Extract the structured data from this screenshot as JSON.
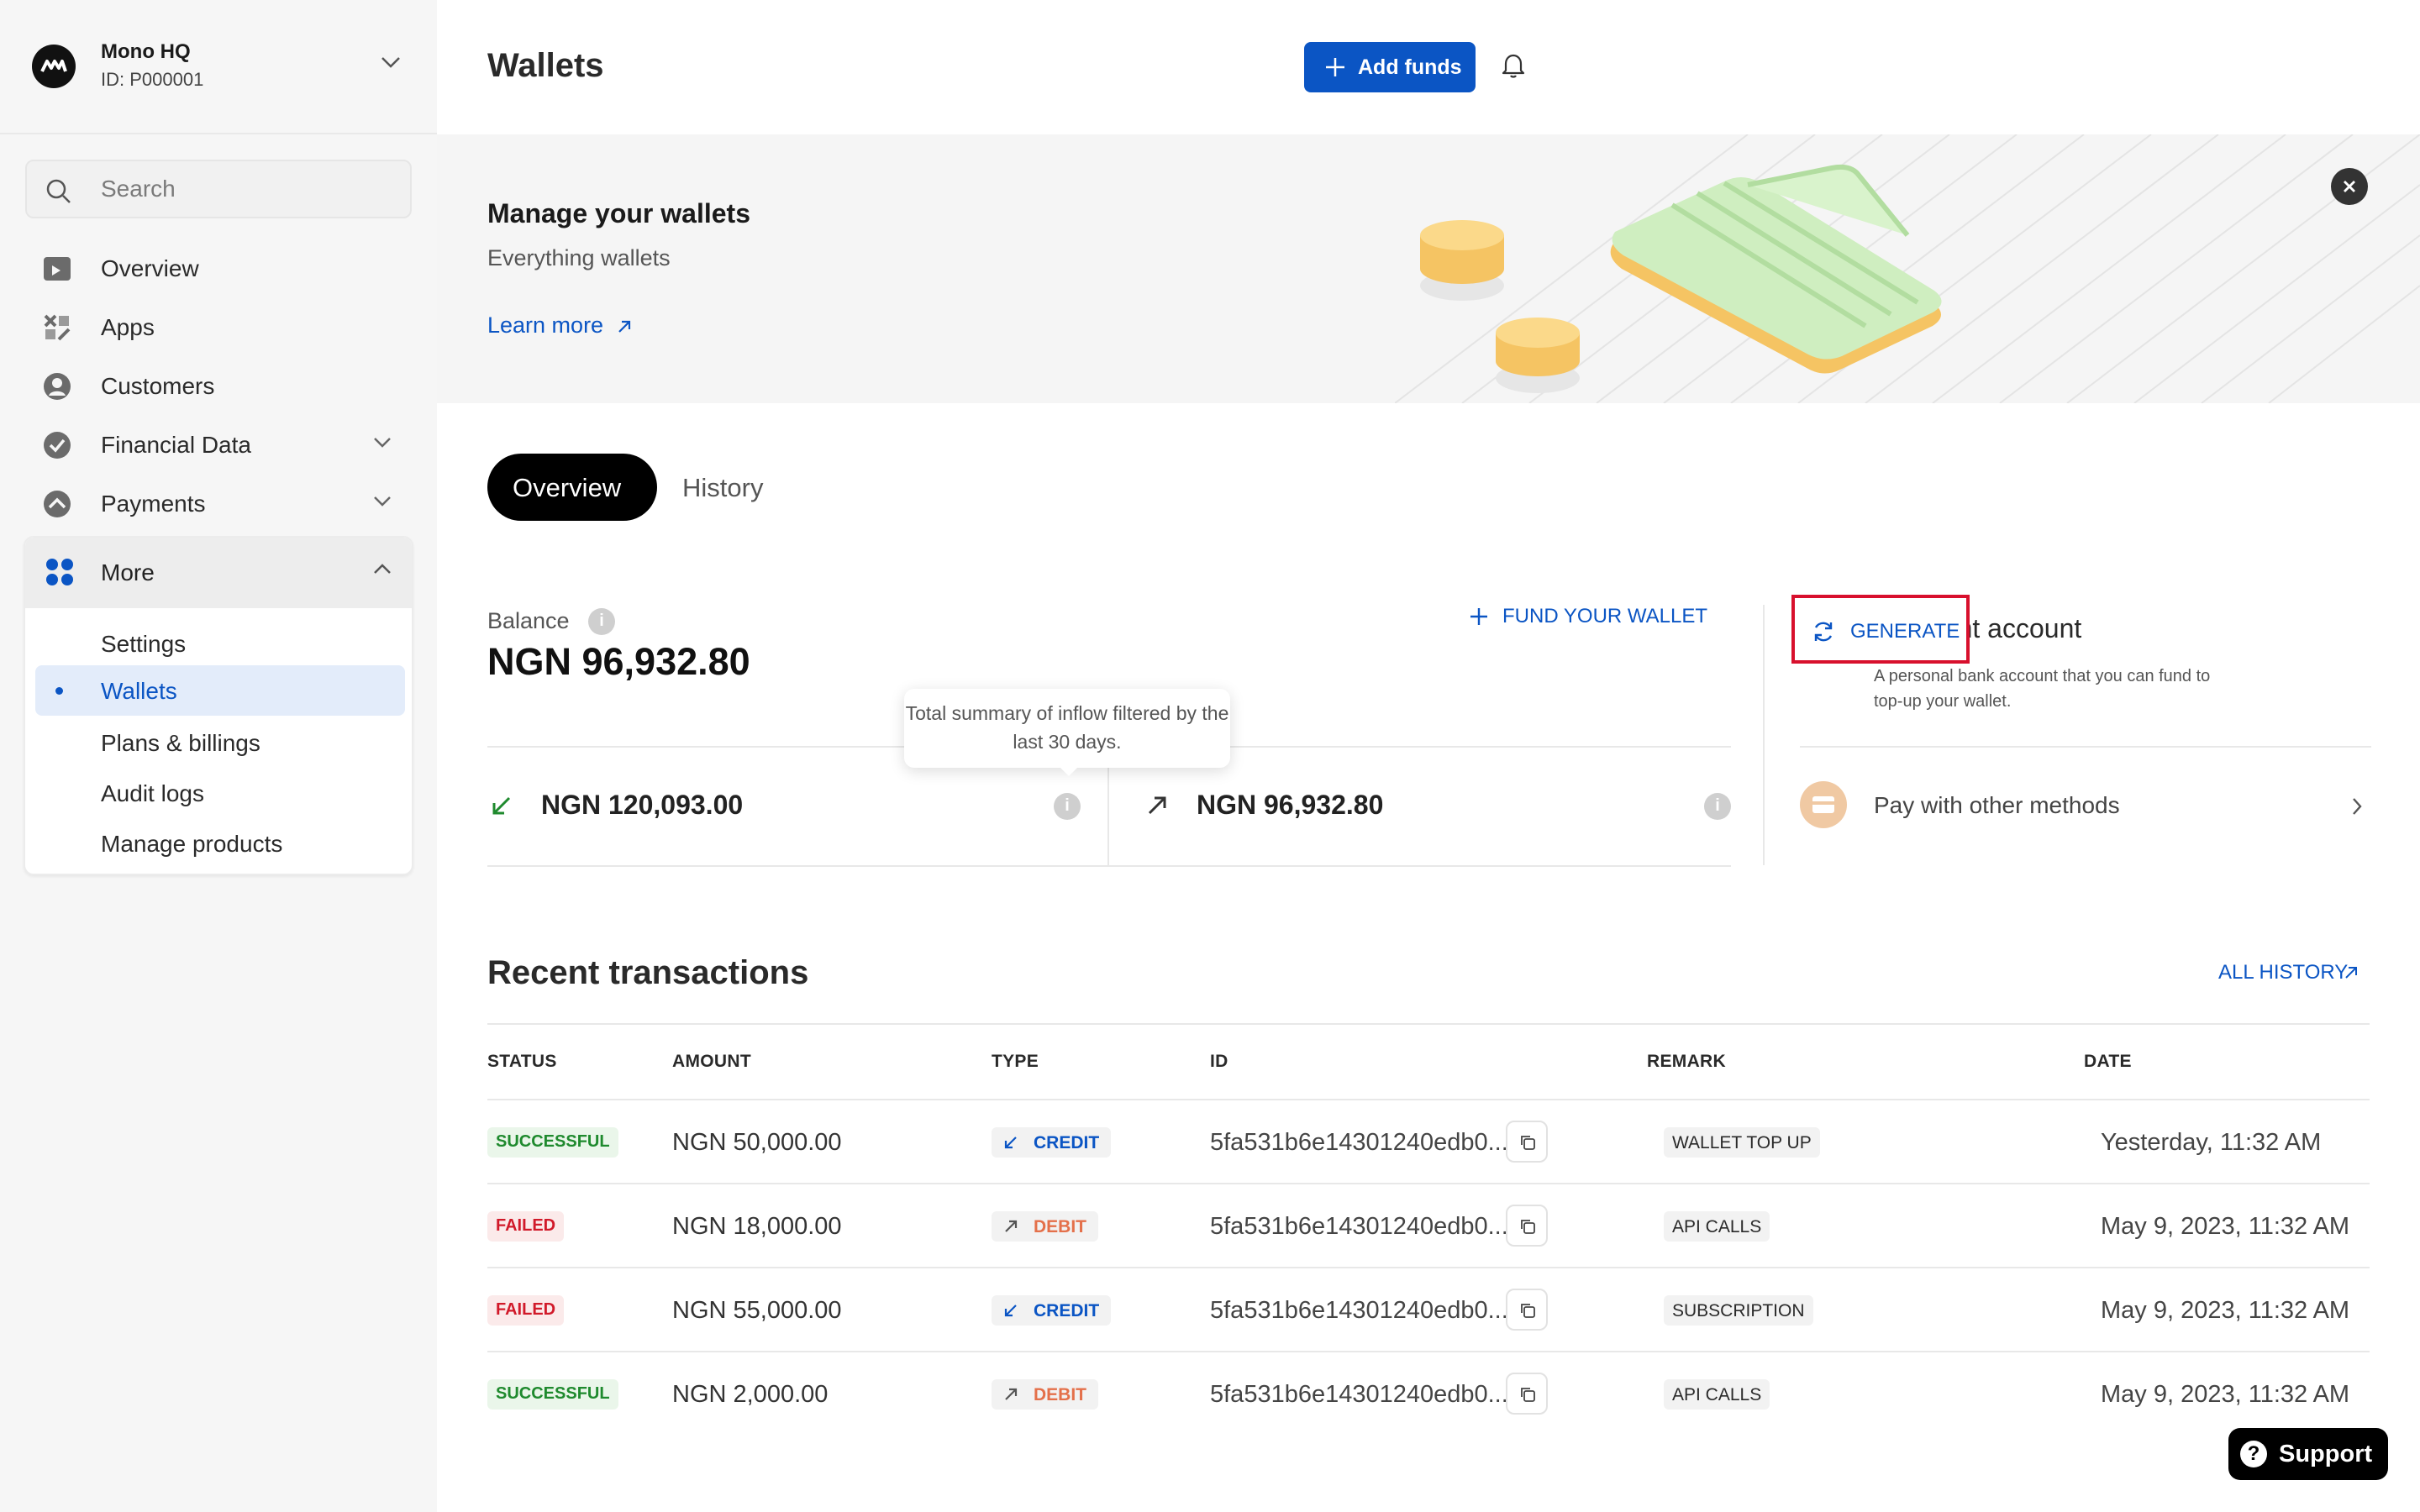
{
  "org": {
    "name": "Mono HQ",
    "id": "ID: P000001"
  },
  "search": {
    "placeholder": "Search"
  },
  "sidebar": {
    "items": [
      {
        "label": "Overview"
      },
      {
        "label": "Apps"
      },
      {
        "label": "Customers"
      },
      {
        "label": "Financial Data"
      },
      {
        "label": "Payments"
      }
    ],
    "more": {
      "label": "More",
      "items": [
        {
          "label": "Settings"
        },
        {
          "label": "Wallets"
        },
        {
          "label": "Plans & billings"
        },
        {
          "label": "Audit logs"
        },
        {
          "label": "Manage products"
        }
      ]
    }
  },
  "header": {
    "title": "Wallets",
    "add_funds": "Add funds"
  },
  "banner": {
    "title": "Manage your wallets",
    "subtitle": "Everything wallets",
    "link": "Learn more"
  },
  "tabs": [
    {
      "label": "Overview"
    },
    {
      "label": "History"
    }
  ],
  "balance": {
    "label": "Balance",
    "value": "NGN 96,932.80",
    "fund_label": "FUND YOUR WALLET",
    "inflow": "NGN 120,093.00",
    "outflow": "NGN 96,932.80",
    "tooltip": "Total summary of inflow filtered by the last 30 days."
  },
  "payment_account": {
    "title": "Payment account",
    "description": "A personal bank account that you can fund to top-up your wallet.",
    "generate": "GENERATE",
    "other_methods": "Pay with other methods"
  },
  "transactions": {
    "title": "Recent transactions",
    "all_history": "ALL HISTORY",
    "columns": [
      "STATUS",
      "AMOUNT",
      "TYPE",
      "ID",
      "REMARK",
      "DATE"
    ],
    "rows": [
      {
        "status": "SUCCESSFUL",
        "amount": "NGN 50,000.00",
        "type": "CREDIT",
        "id": "5fa531b6e14301240edb0...",
        "remark": "WALLET TOP UP",
        "date": "Yesterday, 11:32 AM"
      },
      {
        "status": "FAILED",
        "amount": "NGN 18,000.00",
        "type": "DEBIT",
        "id": "5fa531b6e14301240edb0...",
        "remark": "API CALLS",
        "date": "May 9, 2023, 11:32 AM"
      },
      {
        "status": "FAILED",
        "amount": "NGN 55,000.00",
        "type": "CREDIT",
        "id": "5fa531b6e14301240edb0...",
        "remark": "SUBSCRIPTION",
        "date": "May 9, 2023, 11:32 AM"
      },
      {
        "status": "SUCCESSFUL",
        "amount": "NGN 2,000.00",
        "type": "DEBIT",
        "id": "5fa531b6e14301240edb0...",
        "remark": "API CALLS",
        "date": "May 9, 2023, 11:32 AM"
      }
    ]
  },
  "support": {
    "label": "Support"
  },
  "colors": {
    "primary": "#0b55c4",
    "success": "#1f8a2e",
    "failed": "#d11a2a",
    "debit": "#e4704a",
    "highlight": "#d8102d"
  }
}
